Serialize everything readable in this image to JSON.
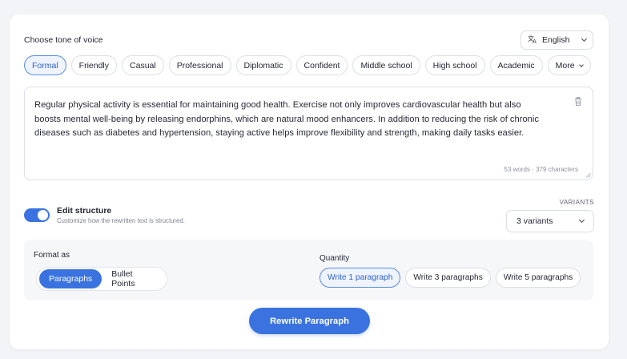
{
  "tone": {
    "label": "Choose tone of voice",
    "options": [
      "Formal",
      "Friendly",
      "Casual",
      "Professional",
      "Diplomatic",
      "Confident",
      "Middle school",
      "High school",
      "Academic"
    ],
    "selected": "Formal",
    "more_label": "More"
  },
  "language": {
    "icon": "translate-icon",
    "value": "English"
  },
  "input": {
    "text": "Regular physical activity is essential for maintaining good health. Exercise not only improves cardiovascular health but also boosts mental well-being by releasing endorphins, which are natural mood enhancers. In addition to reducing the risk of chronic diseases such as diabetes and hypertension, staying active helps improve flexibility and strength, making daily tasks easier.",
    "counts": "53 words · 379 characters"
  },
  "edit_structure": {
    "title": "Edit structure",
    "subtitle": "Customize how the rewritten text is structured.",
    "enabled": true
  },
  "variants": {
    "label": "VARIANTS",
    "value": "3 variants"
  },
  "format": {
    "label": "Format as",
    "options": [
      "Paragraphs",
      "Bullet Points"
    ],
    "selected": "Paragraphs"
  },
  "quantity": {
    "label": "Quantity",
    "options": [
      "Write 1 paragraph",
      "Write 3 paragraphs",
      "Write 5 paragraphs"
    ],
    "selected": "Write 1 paragraph"
  },
  "action": {
    "label": "Rewrite Paragraph"
  },
  "colors": {
    "accent": "#3a73e0",
    "accent_soft": "#eef3fd",
    "border": "#dcdfe6"
  }
}
